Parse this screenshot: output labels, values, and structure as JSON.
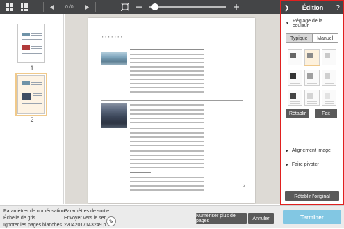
{
  "toolbar": {
    "page_counter": "0 /0",
    "zoom_level": 0.03
  },
  "thumbnails": [
    {
      "number": "1",
      "selected": false
    },
    {
      "number": "2",
      "selected": true
    }
  ],
  "document": {
    "page_number": "2"
  },
  "edit_panel": {
    "title": "Édition",
    "back_icon": "chevron-right-icon",
    "help_icon": "question-icon",
    "color_section": "Réglage de la couleur",
    "tabs": [
      "Typique",
      "Manuel"
    ],
    "active_tab": "Typique",
    "reset_button": "Rétablir",
    "done_button": "Fait",
    "align_section": "Alignement image",
    "rotate_section": "Faire pivoter",
    "reset_original_button": "Rétablir l'original"
  },
  "bottom": {
    "scan_params_title": "Paramètres de numérisation",
    "scan_params_lines": [
      "Échelle de gris",
      "Ignorer les pages blanches"
    ],
    "output_params_title": "Paramètres de sortie",
    "output_params_lines": [
      "Envoyer vers le ser...",
      "22042017143249.p..."
    ],
    "scan_more_button": "Numériser plus de pages",
    "cancel_button": "Annuler",
    "finish_button": "Terminer"
  },
  "colors": {
    "toolbar_bg": "#444547",
    "highlight_border": "#e0201f",
    "finish_bg": "#82c7e3",
    "selection": "#f0c98a"
  }
}
